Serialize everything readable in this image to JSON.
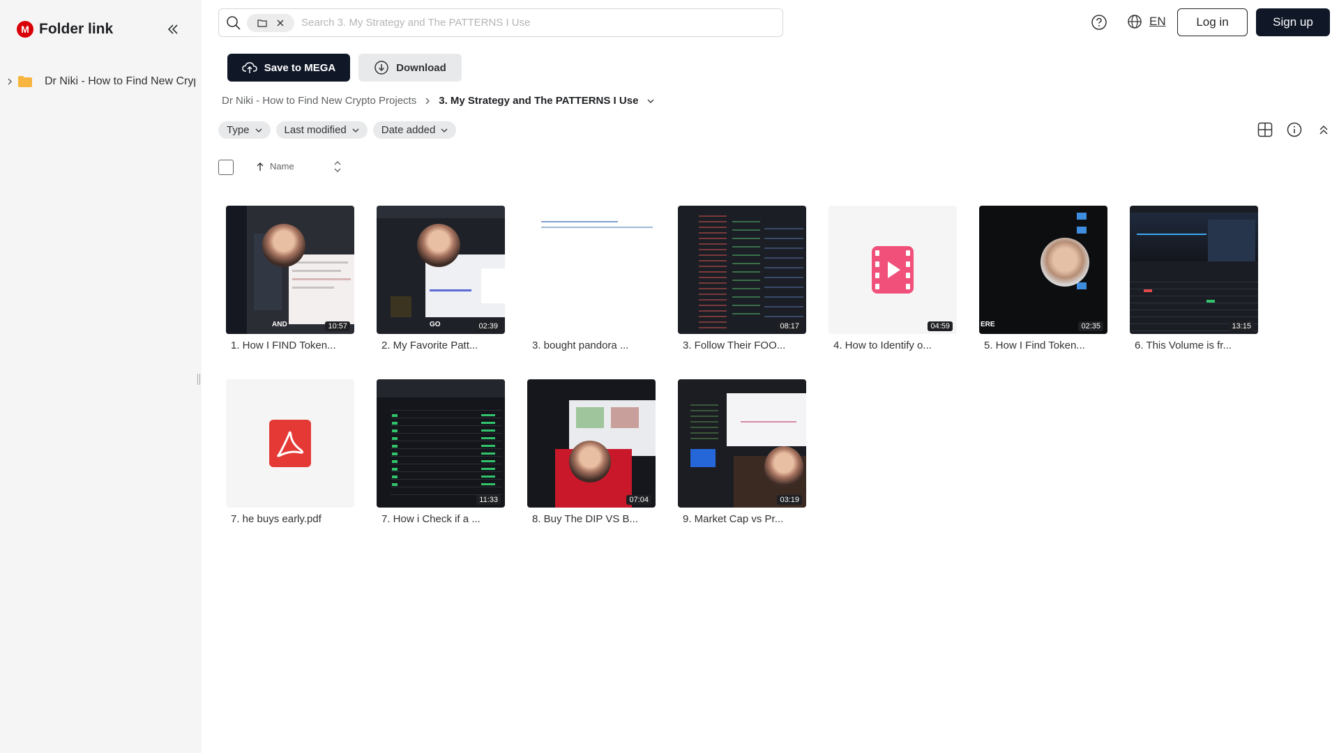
{
  "brand": {
    "logo_letter": "M",
    "name": "Folder link"
  },
  "sidebar": {
    "collapse_label": "«",
    "tree": [
      {
        "label": "Dr Niki - How to Find New Crypto Projects"
      }
    ]
  },
  "search": {
    "placeholder": "Search 3. My Strategy and The PATTERNS I Use"
  },
  "header": {
    "language": "EN",
    "login_label": "Log in",
    "signup_label": "Sign up"
  },
  "actions": {
    "save_label": "Save to MEGA",
    "download_label": "Download"
  },
  "breadcrumb": {
    "parent": "Dr Niki - How to Find New Crypto Projects",
    "current": "3. My Strategy and The PATTERNS I Use"
  },
  "filters": [
    {
      "label": "Type"
    },
    {
      "label": "Last modified"
    },
    {
      "label": "Date added"
    }
  ],
  "sort": {
    "label": "Name"
  },
  "files": [
    {
      "name": "1. How I FIND Token...",
      "kind": "video",
      "duration": "10:57",
      "caption": "AND"
    },
    {
      "name": "2. My Favorite Patt...",
      "kind": "video",
      "duration": "02:39",
      "caption": "GO"
    },
    {
      "name": "3. bought pandora ...",
      "kind": "doc"
    },
    {
      "name": "3. Follow Their FOO...",
      "kind": "video",
      "duration": "08:17"
    },
    {
      "name": "4. How to Identify o...",
      "kind": "video-generic",
      "duration": "04:59"
    },
    {
      "name": "5. How I Find Token...",
      "kind": "video",
      "duration": "02:35",
      "caption": "ERE"
    },
    {
      "name": "6. This Volume is fr...",
      "kind": "video",
      "duration": "13:15"
    },
    {
      "name": "7. he buys early.pdf",
      "kind": "pdf"
    },
    {
      "name": "7. How i Check if a ...",
      "kind": "video",
      "duration": "11:33"
    },
    {
      "name": "8. Buy The DIP VS B...",
      "kind": "video",
      "duration": "07:04"
    },
    {
      "name": "9. Market Cap vs Pr...",
      "kind": "video",
      "duration": "03:19"
    }
  ],
  "colors": {
    "brand_red": "#d90007",
    "primary_dark": "#101828",
    "folder_yellow": "#f7b53f",
    "video_pink": "#f0507a",
    "pdf_red": "#e53935"
  }
}
